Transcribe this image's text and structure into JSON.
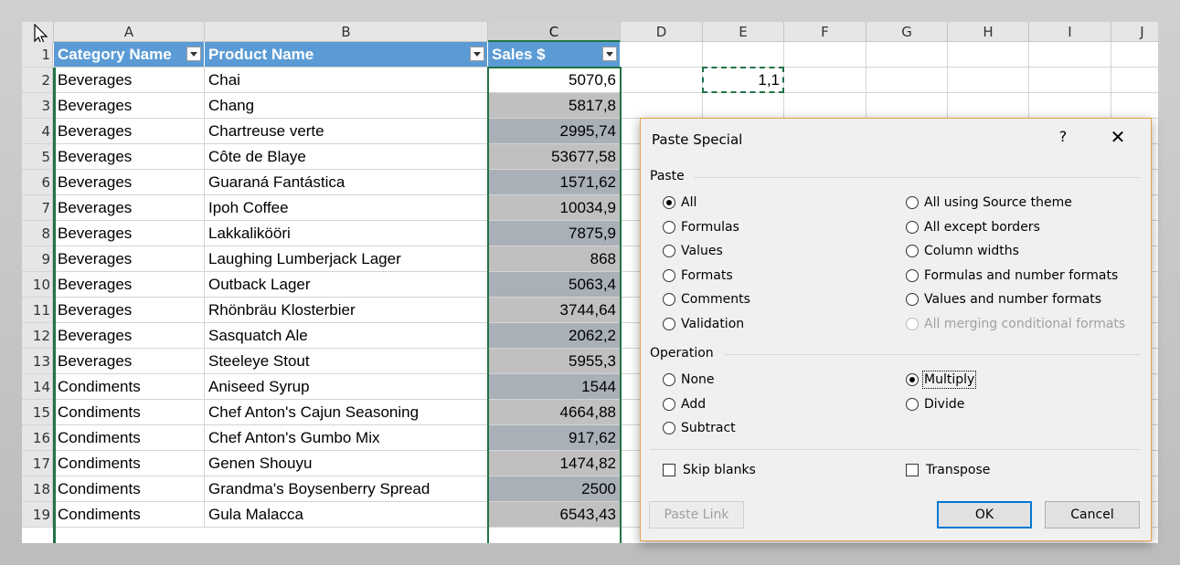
{
  "columns": [
    "A",
    "B",
    "C",
    "D",
    "E",
    "F",
    "G",
    "H",
    "I",
    "J"
  ],
  "header_row": {
    "row": "1",
    "category": "Category Name",
    "product": "Product Name",
    "sales": "Sales $"
  },
  "rows": [
    {
      "n": "2",
      "cat": "Beverages",
      "prod": "Chai",
      "sales": "5070,6"
    },
    {
      "n": "3",
      "cat": "Beverages",
      "prod": "Chang",
      "sales": "5817,8"
    },
    {
      "n": "4",
      "cat": "Beverages",
      "prod": "Chartreuse verte",
      "sales": "2995,74"
    },
    {
      "n": "5",
      "cat": "Beverages",
      "prod": "Côte de Blaye",
      "sales": "53677,58"
    },
    {
      "n": "6",
      "cat": "Beverages",
      "prod": "Guaraná Fantástica",
      "sales": "1571,62"
    },
    {
      "n": "7",
      "cat": "Beverages",
      "prod": "Ipoh Coffee",
      "sales": "10034,9"
    },
    {
      "n": "8",
      "cat": "Beverages",
      "prod": "Lakkalikööri",
      "sales": "7875,9"
    },
    {
      "n": "9",
      "cat": "Beverages",
      "prod": "Laughing Lumberjack Lager",
      "sales": "868"
    },
    {
      "n": "10",
      "cat": "Beverages",
      "prod": "Outback Lager",
      "sales": "5063,4"
    },
    {
      "n": "11",
      "cat": "Beverages",
      "prod": "Rhönbräu Klosterbier",
      "sales": "3744,64"
    },
    {
      "n": "12",
      "cat": "Beverages",
      "prod": "Sasquatch Ale",
      "sales": "2062,2"
    },
    {
      "n": "13",
      "cat": "Beverages",
      "prod": "Steeleye Stout",
      "sales": "5955,3"
    },
    {
      "n": "14",
      "cat": "Condiments",
      "prod": "Aniseed Syrup",
      "sales": "1544"
    },
    {
      "n": "15",
      "cat": "Condiments",
      "prod": "Chef Anton's Cajun Seasoning",
      "sales": "4664,88"
    },
    {
      "n": "16",
      "cat": "Condiments",
      "prod": "Chef Anton's Gumbo Mix",
      "sales": "917,62"
    },
    {
      "n": "17",
      "cat": "Condiments",
      "prod": "Genen Shouyu",
      "sales": "1474,82"
    },
    {
      "n": "18",
      "cat": "Condiments",
      "prod": "Grandma's Boysenberry Spread",
      "sales": "2500"
    },
    {
      "n": "19",
      "cat": "Condiments",
      "prod": "Gula Malacca",
      "sales": "6543,43"
    }
  ],
  "copied_cell": {
    "value": "1,1"
  },
  "dialog": {
    "title": "Paste Special",
    "help": "?",
    "close": "✕",
    "paste_group": "Paste",
    "paste_left": [
      {
        "label": "All",
        "checked": true
      },
      {
        "label": "Formulas",
        "checked": false
      },
      {
        "label": "Values",
        "checked": false
      },
      {
        "label": "Formats",
        "checked": false
      },
      {
        "label": "Comments",
        "checked": false
      },
      {
        "label": "Validation",
        "checked": false
      }
    ],
    "paste_right": [
      {
        "label": "All using Source theme",
        "checked": false,
        "disabled": false
      },
      {
        "label": "All except borders",
        "checked": false,
        "disabled": false
      },
      {
        "label": "Column widths",
        "checked": false,
        "disabled": false
      },
      {
        "label": "Formulas and number formats",
        "checked": false,
        "disabled": false
      },
      {
        "label": "Values and number formats",
        "checked": false,
        "disabled": false
      },
      {
        "label": "All merging conditional formats",
        "checked": false,
        "disabled": true
      }
    ],
    "operation_group": "Operation",
    "op_left": [
      {
        "label": "None",
        "checked": false
      },
      {
        "label": "Add",
        "checked": false
      },
      {
        "label": "Subtract",
        "checked": false
      }
    ],
    "op_right": [
      {
        "label": "Multiply",
        "checked": true
      },
      {
        "label": "Divide",
        "checked": false
      }
    ],
    "skip_blanks": "Skip blanks",
    "transpose": "Transpose",
    "paste_link": "Paste Link",
    "ok": "OK",
    "cancel": "Cancel"
  }
}
